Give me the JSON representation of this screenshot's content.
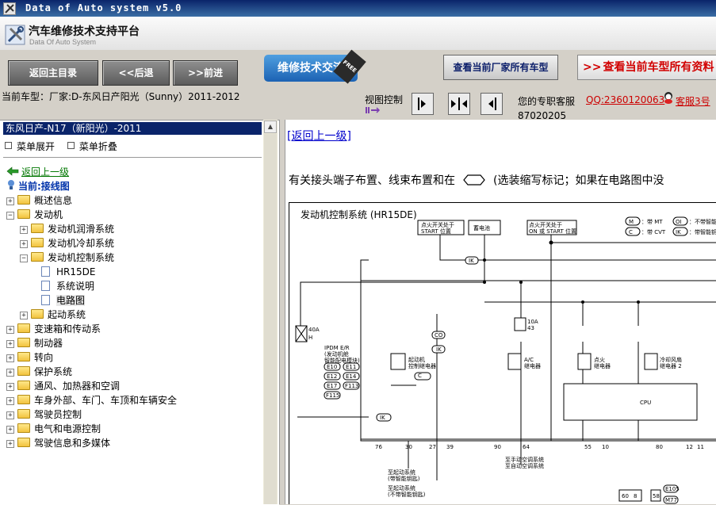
{
  "window": {
    "title": "Data of Auto system v5.0"
  },
  "header": {
    "app_name": "汽车维修技术支持平台",
    "app_subtitle": "Data Of Auto System"
  },
  "toolbar": {
    "home_label": "返回主目录",
    "back_label": "<<后退",
    "forward_label": ">>前进",
    "forum_label": "维修技术交流",
    "forum_badge": "FREE",
    "brand_models_label": "查看当前厂家所有车型",
    "model_docs_label": "查看当前车型所有资料"
  },
  "infobar": {
    "current_model": "当前车型：厂家:D-东风日产阳光（Sunny）2011-2012",
    "view_control_label": "视图控制",
    "service_line1": "您的专职客服",
    "service_phone": "87020205",
    "qq_label": "QQ:2360120063",
    "cs_label": "客服3号"
  },
  "tree": {
    "title": "东风日产-N17（新阳光）-2011",
    "expand_label": "菜单展开",
    "collapse_label": "菜单折叠",
    "back_label": "返回上一级",
    "current_label": "当前:接线图",
    "items": [
      {
        "label": "概述信息",
        "level": 0,
        "type": "folder",
        "expanded": false
      },
      {
        "label": "发动机",
        "level": 0,
        "type": "folder",
        "expanded": true
      },
      {
        "label": "发动机润滑系统",
        "level": 1,
        "type": "folder",
        "expanded": false
      },
      {
        "label": "发动机冷却系统",
        "level": 1,
        "type": "folder",
        "expanded": false
      },
      {
        "label": "发动机控制系统",
        "level": 1,
        "type": "folder",
        "expanded": true
      },
      {
        "label": "HR15DE",
        "level": 2,
        "type": "doc",
        "expanded": false
      },
      {
        "label": "系统说明",
        "level": 2,
        "type": "doc",
        "expanded": false
      },
      {
        "label": "电路图",
        "level": 2,
        "type": "doc",
        "expanded": false,
        "selected": true
      },
      {
        "label": "起动系统",
        "level": 1,
        "type": "folder",
        "expanded": false
      },
      {
        "label": "变速箱和传动系",
        "level": 0,
        "type": "folder",
        "expanded": false
      },
      {
        "label": "制动器",
        "level": 0,
        "type": "folder",
        "expanded": false
      },
      {
        "label": "转向",
        "level": 0,
        "type": "folder",
        "expanded": false
      },
      {
        "label": "保护系统",
        "level": 0,
        "type": "folder",
        "expanded": false
      },
      {
        "label": "通风、加热器和空调",
        "level": 0,
        "type": "folder",
        "expanded": false
      },
      {
        "label": "车身外部、车门、车顶和车辆安全",
        "level": 0,
        "type": "folder",
        "expanded": false
      },
      {
        "label": "驾驶员控制",
        "level": 0,
        "type": "folder",
        "expanded": false
      },
      {
        "label": "电气和电源控制",
        "level": 0,
        "type": "folder",
        "expanded": false
      },
      {
        "label": "驾驶信息和多媒体",
        "level": 0,
        "type": "folder",
        "expanded": false
      }
    ]
  },
  "content": {
    "up_link": "[返回上一级]",
    "description_start": "有关接头端子布置、线束布置和在",
    "description_end": "(选装缩写标记；如果在电路图中没",
    "diagram": {
      "title": "发动机控制系统 (HR15DE)",
      "labels": {
        "ign_start": "点火开关处于\nSTART 位置",
        "battery": "蓄电池",
        "ign_on_start": "点火开关处于\nON 或 START 位置",
        "legend_m": "M",
        "legend_m_text": "：带 MT",
        "legend_c": "C",
        "legend_c_text": "：带 CVT",
        "legend_oi": "OI",
        "legend_oi_text": "：不带智能钥",
        "legend_ik": "IK",
        "legend_ik_text": "：带智能钥匙",
        "ik": "IK",
        "co": "CO",
        "fuse_40a": "40A",
        "fuse_h": "H",
        "fuse_10a": "10A",
        "fuse_43": "43",
        "ipdm": "IPDM E/R\n(发动机舱\n智能配电模块)",
        "e10": "E10",
        "e11": "E11",
        "e12": "E12",
        "e14": "E14",
        "e17": "E17",
        "f113": "F113",
        "f115": "F115",
        "starter_relay": "起动机\n控制继电器",
        "ac_relay": "A/C\n继电器",
        "ign_relay": "点火\n继电器",
        "fan_relay": "冷却风扇\n继电器 2",
        "cpu": "CPU",
        "pin_76": "76",
        "pin_30": "30",
        "pin_27": "27",
        "pin_39": "39",
        "pin_90": "90",
        "pin_64": "64",
        "pin_55": "55",
        "pin_10": "10",
        "pin_80": "80",
        "pin_12": "12",
        "pin_11": "11",
        "to_start_1": "至起动系统\n(带智能钥匙)",
        "to_start_2": "至起动系统\n(不带智能钥匙)",
        "to_ac": "至手动空调系统\n至自动空调系统",
        "pin_60": "60",
        "pin_8": "8",
        "pin_58": "58",
        "e105": "E105",
        "m77": "M77"
      }
    }
  }
}
